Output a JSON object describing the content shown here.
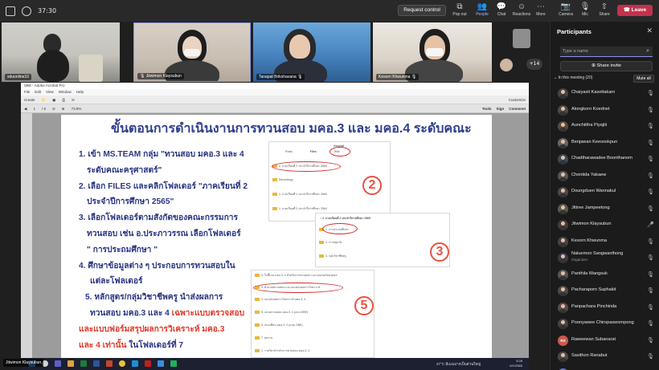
{
  "topbar": {
    "time": "37:30",
    "request_control": "Request control",
    "tools": [
      {
        "label": "Pop out",
        "icon": "popout-icon",
        "glyph": "⧉"
      },
      {
        "label": "People",
        "icon": "people-icon",
        "glyph": "👥"
      },
      {
        "label": "Chat",
        "icon": "chat-icon",
        "glyph": "💬"
      },
      {
        "label": "Reactions",
        "icon": "reactions-icon",
        "glyph": "☺"
      },
      {
        "label": "More",
        "icon": "more-icon",
        "glyph": "⋯"
      },
      {
        "label": "Camera",
        "icon": "camera-icon",
        "glyph": "📷"
      },
      {
        "label": "Mic",
        "icon": "mic-off-icon",
        "glyph": "🎙"
      },
      {
        "label": "Share",
        "icon": "share-icon",
        "glyph": "⇧"
      }
    ],
    "leave": "Leave",
    "colors": {
      "leave": "#c4314b",
      "accent": "#8f93e6"
    }
  },
  "videos": [
    {
      "name": "sduonline10"
    },
    {
      "name": "Jitwimon Klaysubun"
    },
    {
      "name": "Tanapat Brikshavana"
    },
    {
      "name": "Kesorn Khwunma"
    }
  ],
  "overflow_count": "+14",
  "acrobat": {
    "title": "มคอ - Adobe Acrobat Pro",
    "menu": [
      "File",
      "Edit",
      "View",
      "Window",
      "Help"
    ],
    "toolbar1_left": "Create",
    "toolbar1_right": "Customize",
    "page_field": "1",
    "page_total": "/ 6",
    "zoom": "73.8%",
    "panes": [
      "Tools",
      "Sign",
      "Comment"
    ]
  },
  "slide": {
    "title": "ขั้นตอนการดำเนินงานการทวนสอบ มคอ.3 และ มคอ.4 ระดับคณะ",
    "lines": [
      {
        "text": "1. เข้า MS.TEAM กลุ่ม \"ทวนสอบ มคอ.3 และ 4",
        "hl": false
      },
      {
        "text": "ระดับคณะครุศาสตร์\"",
        "hl": false
      },
      {
        "text": "2. เลือก FILES และคลิกโฟลเดอร์ \"ภาคเรียนที่ 2",
        "hl": false
      },
      {
        "text": "ประจำปีการศึกษา 2565\"",
        "hl": false
      },
      {
        "text": "3. เลือกโฟลเดอร์ตามสังกัดของคณะกรรมการ",
        "hl": false
      },
      {
        "text": "ทวนสอบ เช่น อ.ประภาวรรณ เลือกโฟลเดอร์",
        "hl": false
      },
      {
        "text": "\" การประถมศึกษา \"",
        "hl": false
      },
      {
        "text": "4. ศึกษาข้อมูลต่าง ๆ ประกอบการทวนสอบใน",
        "hl": false
      },
      {
        "text": "แต่ละโฟลเดอร์",
        "hl": false
      }
    ],
    "line5a": "5. หลักสูตร/กลุ่มวิชาชีพครู นำส่งผลการ",
    "line5b_pre": "ทวนสอบ มคอ.3 และ 4 ",
    "line5b_hl": "เฉพาะแบบตรวจสอบ",
    "line5c_hl": "และแบบฟอร์มสรุปผลการวิเคราะห์ มคอ.3",
    "line5d_hl": "และ 4 เท่านั้น",
    "line5d_post": " ในโฟลเดอร์ที่ 7",
    "shot2": {
      "tabs": [
        "Posts",
        "Files",
        "Wiki"
      ],
      "header": "General",
      "rows": [
        "2. ภาคเรียนที่ 2 ประจำปีการศึกษา 2565",
        "Recordings",
        "1. ภาคเรียนที่ 1 ประจำปีการศึกษา 2565",
        "1. ภาคเรียนที่ 2 ประจำปีการศึกษา 2564"
      ],
      "num": "2"
    },
    "shot3": {
      "header": "2. ภาคเรียนที่ 2 ประจำปีการศึกษา 2565",
      "rows": [
        "1. การประถมศึกษา",
        "2. การปฐมวัย",
        "3. กลุ่มวิชาชีพครู"
      ],
      "num": "3"
    },
    "shot5": {
      "rows": [
        "2. ใบชี้แจง มคอ.3, 4 สำหรับการทวนสอบ และแบบฟอร์มสรุปผล",
        "3. ตัวแบบตรวจสอบ และแบบสรุปผลการวิเคราะห์",
        "4. แบบสรุปผลการวิเคราะห์ มคอ.3, 4",
        "5. แบบตรวจสอบ มคอ.3, 4 (แบบ OBE)",
        "6. แบบเขียน มคอ.3, 4 (แบบ OBE)",
        "7. ผลงาน",
        "1. รายวิชาสำหรับการทวนสอบ มคอ.3, 4"
      ],
      "num": "5"
    }
  },
  "taskbar": {
    "weather": "27°C  มีเมฆมากเป็นส่วนใหญ่",
    "time": "9:28",
    "date": "6/1/2566"
  },
  "presenter_name": "Jitwimon Klaysubun",
  "panel": {
    "title": "Participants",
    "search_placeholder": "Type a name",
    "share_invite": "Share invite",
    "section": "In this meeting (20)",
    "mute_all": "Mute all",
    "participants": [
      {
        "name": "Chaiyasit Kasettakarn",
        "avatar": "photo",
        "bg": "#444"
      },
      {
        "name": "Alongkorn Koednet",
        "avatar": "photo",
        "bg": "#4a4a4a"
      },
      {
        "name": "Aunchittha Piyajiti",
        "avatar": "photo",
        "bg": "#5a4a3a"
      },
      {
        "name": "Benjawan Keesookpun",
        "avatar": "photo",
        "bg": "#666"
      },
      {
        "name": "Chadtharawadee Boonthanom",
        "avatar": "photo",
        "bg": "#3a4a5a"
      },
      {
        "name": "Chontida Yakaew",
        "avatar": "photo",
        "bg": "#555"
      },
      {
        "name": "Doungduen Wannakul",
        "avatar": "photo",
        "bg": "#4a4a4a"
      },
      {
        "name": "Jittree Jampeetong",
        "avatar": "photo",
        "bg": "#5a5a4a"
      },
      {
        "name": "Jitwimon Klaysubun",
        "avatar": "photo",
        "bg": "#4a3a3a",
        "mic_on": true
      },
      {
        "name": "Kesorn Khwunma",
        "avatar": "photo",
        "bg": "#444"
      },
      {
        "name": "Naluemon Sangwanthong",
        "sub": "Organizer",
        "avatar": "photo",
        "bg": "#3a3a4a"
      },
      {
        "name": "Panthila Wangsuk",
        "avatar": "photo",
        "bg": "#555"
      },
      {
        "name": "Pacharaporn Suphakit",
        "avatar": "photo",
        "bg": "#4a4a4a"
      },
      {
        "name": "Panpachara Pinchinda",
        "avatar": "photo",
        "bg": "#5a4a4a"
      },
      {
        "name": "Poonyawee Chiropaswornpong",
        "avatar": "photo",
        "bg": "#444"
      },
      {
        "name": "Raweewan Subanarat",
        "avatar": "initials",
        "initials": "RS",
        "bg": "#c95b4b"
      },
      {
        "name": "Sasithon Ranabut",
        "avatar": "photo",
        "bg": "#4a4a4a"
      },
      {
        "name": "sduonline10",
        "avatar": "initials",
        "initials": "S",
        "bg": "#6b72c9",
        "sharing": true
      }
    ]
  }
}
